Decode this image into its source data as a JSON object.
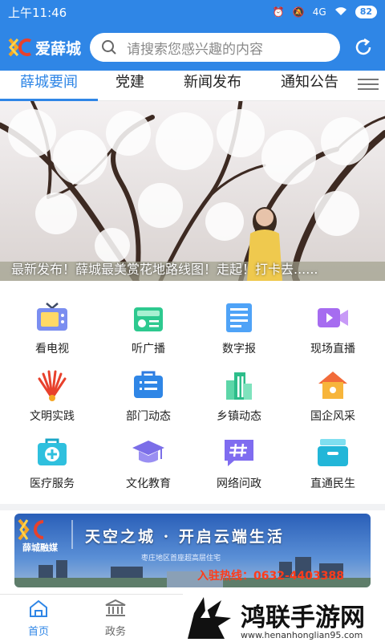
{
  "status": {
    "time": "上午11:46",
    "signal": "4G",
    "battery": "82"
  },
  "app": {
    "logo_text": "爱薛城"
  },
  "search": {
    "placeholder": "请搜索您感兴趣的内容"
  },
  "tabs": [
    {
      "label": "薛城要闻",
      "active": true
    },
    {
      "label": "党建"
    },
    {
      "label": "新闻发布"
    },
    {
      "label": "通知公告"
    }
  ],
  "banner": {
    "caption": "最新发布！薛城最美赏花地路线图！走起！打卡去......"
  },
  "grid": [
    {
      "label": "看电视",
      "icon": "tv-icon"
    },
    {
      "label": "听广播",
      "icon": "radio-icon"
    },
    {
      "label": "数字报",
      "icon": "newspaper-icon"
    },
    {
      "label": "现场直播",
      "icon": "video-camera-icon"
    },
    {
      "label": "文明实践",
      "icon": "fan-emblem-icon"
    },
    {
      "label": "部门动态",
      "icon": "briefcase-icon"
    },
    {
      "label": "乡镇动态",
      "icon": "buildings-icon"
    },
    {
      "label": "国企风采",
      "icon": "home-icon"
    },
    {
      "label": "医疗服务",
      "icon": "medical-kit-icon"
    },
    {
      "label": "文化教育",
      "icon": "graduation-cap-icon"
    },
    {
      "label": "网络问政",
      "icon": "hashtag-chat-icon"
    },
    {
      "label": "直通民生",
      "icon": "inbox-icon"
    }
  ],
  "ad": {
    "logo_text": "薛城融媒",
    "title": "天空之城 · 开启云端生活",
    "sub": "枣庄地区首座超高层住宅",
    "hotline": "入驻热线：0632-4403388"
  },
  "nav": [
    {
      "label": "首页",
      "icon": "home-icon",
      "active": true
    },
    {
      "label": "政务",
      "icon": "government-icon"
    }
  ],
  "watermark": {
    "text": "鸿联手游网",
    "url": "www.henanhonglian95.com"
  },
  "colors": {
    "primary": "#2f86e6"
  }
}
